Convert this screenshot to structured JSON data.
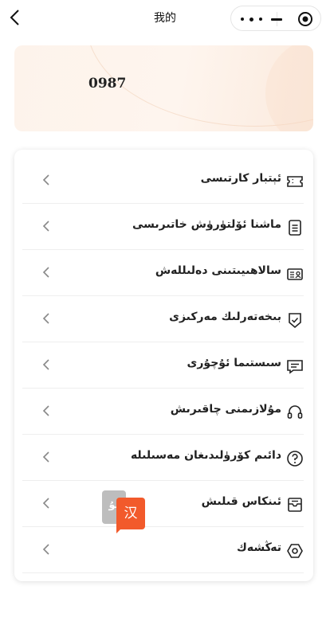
{
  "navbar": {
    "title": "我的"
  },
  "profile": {
    "user_id": "0987"
  },
  "menu": [
    {
      "label": "ئېتبار كارتىسى",
      "icon": "ticket-icon"
    },
    {
      "label": "ماشنا ئۆلتۈرۈش خاتىرىسى",
      "icon": "document-icon"
    },
    {
      "label": "سالاھىيىتىنى دەلىللەش",
      "icon": "id-card-icon"
    },
    {
      "label": "بىخەتەرلىك مەركىزى",
      "icon": "shield-icon"
    },
    {
      "label": "سىستىما ئۇچۇرى",
      "icon": "message-icon"
    },
    {
      "label": "مۇلازىمنى چاقىرىش",
      "icon": "headset-icon"
    },
    {
      "label": "دائىم كۆرۈلىدىغان مەسىلىلە",
      "icon": "question-icon"
    },
    {
      "label": "ئىنكاس قىلىش",
      "icon": "feedback-icon"
    },
    {
      "label": "تەڭشەك",
      "icon": "settings-icon"
    }
  ],
  "language_toggle": {
    "uyghur_label": "ئۇ",
    "chinese_label": "汉"
  },
  "colors": {
    "accent": "#f25a2b",
    "banner": "#fdf3eb"
  }
}
